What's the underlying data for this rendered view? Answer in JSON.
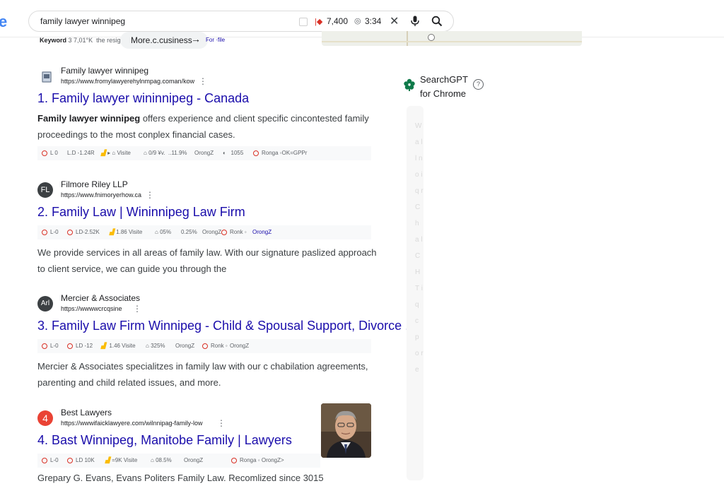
{
  "search": {
    "query": "family lawyer winnipeg",
    "count": "7,400",
    "time": "3:34"
  },
  "logo_fragment": "e",
  "toolbar": {
    "keyword_label": "Keyword",
    "keyword_value": "3 7,01°K",
    "keyword_extra": "the resign",
    "more_button": "More.c.cusiness",
    "for_link": "For ·file"
  },
  "results": [
    {
      "site_name": "Family lawyer winnipeg",
      "url": "https://www.fromylawyerehylnmpag.coman/kow",
      "title": "1. Family lawyer wininnipeg - Canada",
      "desc_bold": "Family lawyer winnipeg",
      "desc": " offers experience and client specific cincontested family proceedings to the most conplex financial cases.",
      "metrics": [
        "L 0",
        "L.D -1.24R",
        "Visite",
        "0/9 ¥v.",
        "..11.9%",
        "OrongZ",
        "1055",
        "Ronga",
        "OK=GPPr"
      ]
    },
    {
      "site_name": "Filmore Riley LLP",
      "url": "https://www.fnimoryerhow.ca",
      "favicon_text": "FL",
      "title": "2. Family Law | Wininnipeg Law Firm",
      "desc": "We provide services in all areas of family law. With our signature paslized approach to client service, we can guide you through the",
      "metrics": [
        "L-0",
        "LD-2.52K",
        "1.86 Visite",
        "05%",
        "0.25%",
        "OrongZ",
        "Ronk",
        "OrongZ"
      ]
    },
    {
      "site_name": "Mercier & Associates",
      "url": "https://wwwwcrcqsine",
      "favicon_text": "Arl",
      "title": "3. Family Law Firm Winnipeg - Child & Spousal Support, Divorce ...",
      "desc": "Mercier & Associates specialitzes in family law with our c chabilation agreements, parenting and child related issues, and more.",
      "metrics": [
        "L-0",
        "LD -12",
        "1.46 Visite",
        "325%",
        "OrongZ",
        "Ronk",
        "OrongZ"
      ]
    },
    {
      "site_name": "Best Lawyers",
      "url": "https://wwwifaicklawyere.com/wilnnipag-family-low",
      "favicon_text": "4",
      "title": "4. Bast Winnipeg, Manitobe Family | Lawyers",
      "desc": "Grepary G. Evans, Evans Politers Family Law. Recomlized since 3015",
      "metrics": [
        "L-0",
        "LD 10K",
        "=9K",
        "Visite",
        "08.5%",
        "OrongZ",
        "Ronga",
        "OrongZ>"
      ]
    }
  ],
  "sidebar": {
    "title_line1": "SearchGPT",
    "title_line2": "for Chrome",
    "help": "?",
    "faint_letters": "W a l l n o i q r C h a l C H T i q c p o r e"
  },
  "colors": {
    "link": "#1a0dab",
    "accent_red": "#d93025",
    "best_lawyers_icon": "#ea4335",
    "searchgpt_icon": "#0f7a4a"
  }
}
